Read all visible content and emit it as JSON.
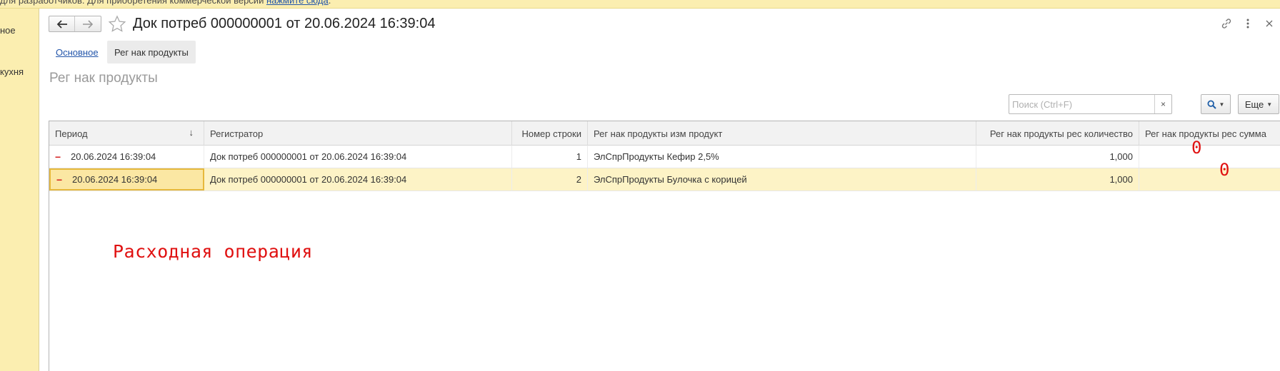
{
  "top_banner": {
    "text": "для разработчиков. Для приобретения коммерческой версии ",
    "link": "нажмите сюда",
    "suffix": "."
  },
  "left_panel": {
    "items": [
      "ное",
      "кухня"
    ]
  },
  "header": {
    "title": "Док потреб 000000001 от 20.06.2024 16:39:04",
    "nav_back": "back-arrow-icon",
    "nav_forward": "forward-arrow-icon",
    "right_icons": [
      "link-icon",
      "more-vert-icon",
      "close-icon"
    ]
  },
  "tabs": [
    {
      "label": "Основное",
      "active": false
    },
    {
      "label": "Рег нак продукты",
      "active": true
    }
  ],
  "section_title": "Рег нак продукты",
  "search": {
    "placeholder": "Поиск (Ctrl+F)",
    "value": "",
    "clear": "×"
  },
  "toolbar": {
    "more_label": "Еще"
  },
  "table": {
    "columns": [
      "Период",
      "Регистратор",
      "Номер строки",
      "Рег нак продукты изм продукт",
      "Рег нак продукты рес количество",
      "Рег нак продукты рес сумма"
    ],
    "rows": [
      {
        "period": "20.06.2024 16:39:04",
        "registrar": "Док потреб 000000001 от 20.06.2024 16:39:04",
        "line": "1",
        "product": "ЭлСпрПродукты Кефир 2,5%",
        "qty": "1,000",
        "sum": ""
      },
      {
        "period": "20.06.2024 16:39:04",
        "registrar": "Док потреб 000000001 от 20.06.2024 16:39:04",
        "line": "2",
        "product": "ЭлСпрПродукты Булочка с корицей",
        "qty": "1,000",
        "sum": ""
      }
    ]
  },
  "annotations": {
    "operation": "Расходная операция",
    "zero_1": "0",
    "zero_2": "0"
  },
  "colors": {
    "panel_yellow": "#fbeeb0",
    "selected_row": "#fdf3c6",
    "annotation_red": "#e01010",
    "link_blue": "#2255aa"
  }
}
